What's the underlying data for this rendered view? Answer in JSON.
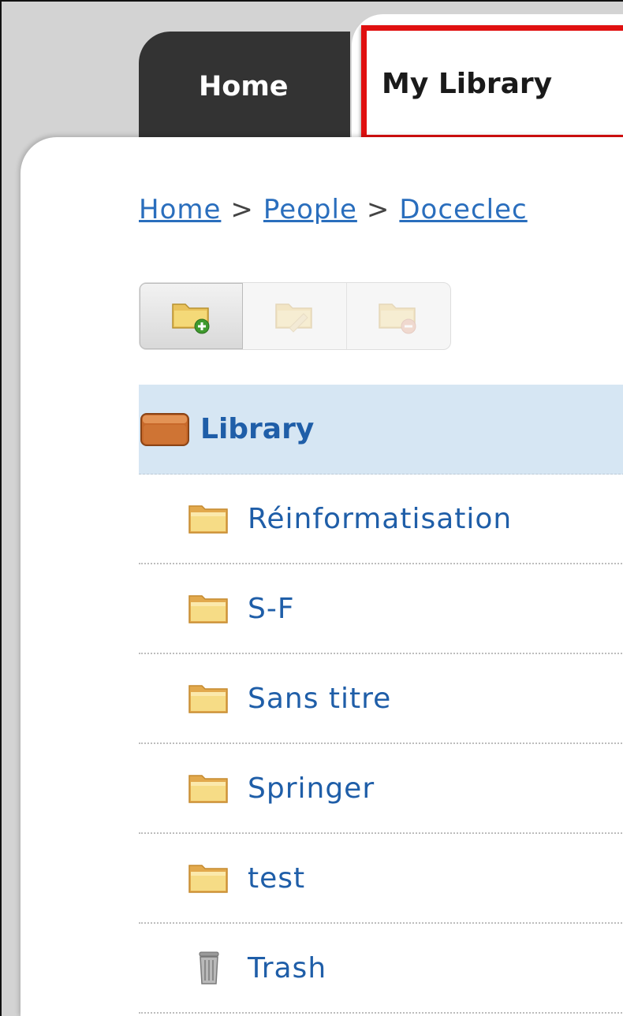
{
  "tabs": {
    "home": "Home",
    "my_library": "My Library"
  },
  "breadcrumb": {
    "items": [
      "Home",
      "People",
      "Doceclec"
    ],
    "separator": ">"
  },
  "toolbar": {
    "buttons": [
      {
        "icon": "folder-add-icon",
        "state": "active"
      },
      {
        "icon": "folder-edit-icon",
        "state": "disabled"
      },
      {
        "icon": "folder-remove-icon",
        "state": "disabled"
      }
    ]
  },
  "library": {
    "root_label": "Library",
    "folders": [
      "Réinformatisation",
      "S-F",
      "Sans titre",
      "Springer",
      "test"
    ],
    "trash_label": "Trash"
  },
  "colors": {
    "tab_dark": "#333333",
    "highlight": "#e01010",
    "link": "#2a6ebd",
    "selected_row": "#d6e6f3"
  }
}
